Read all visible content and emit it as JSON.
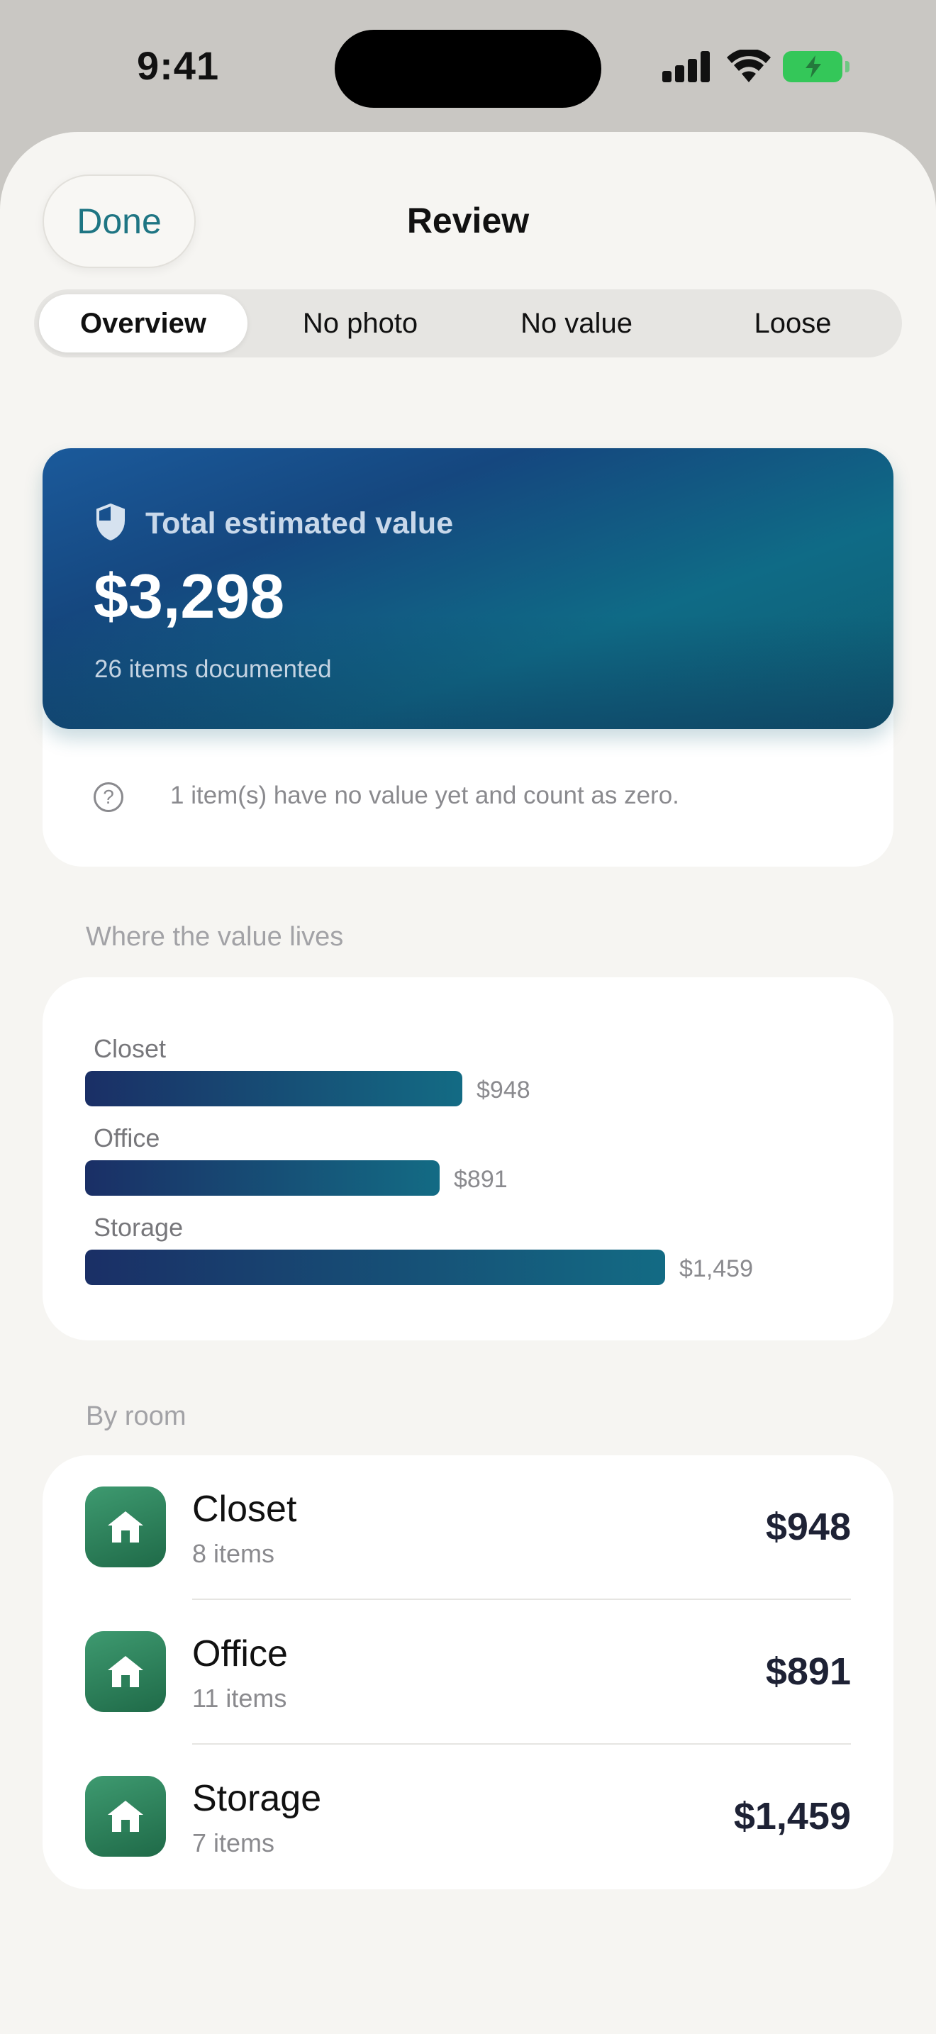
{
  "status_bar": {
    "time": "9:41"
  },
  "header": {
    "done_label": "Done",
    "title": "Review"
  },
  "tabs": [
    {
      "label": "Overview",
      "active": true
    },
    {
      "label": "No photo",
      "active": false
    },
    {
      "label": "No value",
      "active": false
    },
    {
      "label": "Loose",
      "active": false
    }
  ],
  "summary": {
    "label": "Total estimated value",
    "value": "$3,298",
    "subtitle": "26 items documented",
    "note": "1 item(s) have no value yet and count as zero."
  },
  "value_section": {
    "title": "Where the value lives"
  },
  "chart_data": {
    "type": "bar",
    "orientation": "horizontal",
    "categories": [
      "Closet",
      "Office",
      "Storage"
    ],
    "values": [
      948,
      891,
      1459
    ],
    "value_labels": [
      "$948",
      "$891",
      "$1,459"
    ]
  },
  "rooms_section": {
    "title": "By room"
  },
  "rooms": [
    {
      "name": "Closet",
      "count": "8 items",
      "value": "$948",
      "icon": "home-icon"
    },
    {
      "name": "Office",
      "count": "11 items",
      "value": "$891",
      "icon": "home-icon"
    },
    {
      "name": "Storage",
      "count": "7 items",
      "value": "$1,459",
      "icon": "home-icon"
    }
  ],
  "colors": {
    "accent": "#1e7583",
    "card_gradient_start": "#1b5a9b",
    "card_gradient_end": "#0e5c70",
    "bar_gradient_start": "#1a2f66",
    "bar_gradient_end": "#136b84",
    "room_icon": "#2e7d58"
  }
}
